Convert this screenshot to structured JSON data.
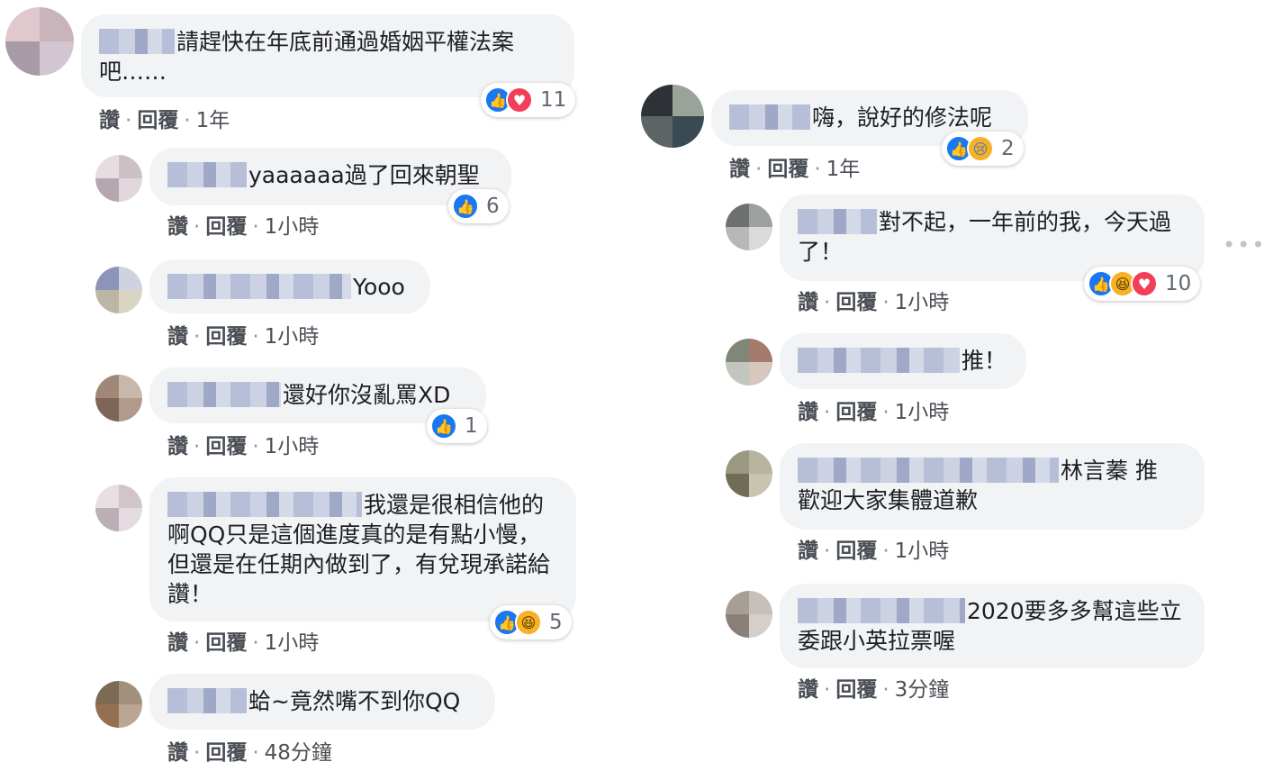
{
  "comments": [
    {
      "text": "請趕快在年底前通過婚姻平權法案吧……",
      "like_label": "讚",
      "reply_label": "回覆",
      "time": "1年",
      "reactions": {
        "icons": [
          "like-icon",
          "love-icon"
        ],
        "count": "11"
      }
    },
    {
      "text": "yaaaaaa過了回來朝聖",
      "like_label": "讚",
      "reply_label": "回覆",
      "time": "1小時",
      "reactions": {
        "icons": [
          "like-icon"
        ],
        "count": "6"
      }
    },
    {
      "text": "Yooo",
      "like_label": "讚",
      "reply_label": "回覆",
      "time": "1小時"
    },
    {
      "text": "還好你沒亂罵XD",
      "like_label": "讚",
      "reply_label": "回覆",
      "time": "1小時",
      "reactions": {
        "icons": [
          "like-icon"
        ],
        "count": "1"
      }
    },
    {
      "text": "我還是很相信他的啊QQ只是這個進度真的是有點小慢，但還是在任期內做到了，有兌現承諾給讚！",
      "like_label": "讚",
      "reply_label": "回覆",
      "time": "1小時",
      "reactions": {
        "icons": [
          "like-icon",
          "haha-icon"
        ],
        "count": "5"
      }
    },
    {
      "text": "蛤~竟然嘴不到你QQ",
      "like_label": "讚",
      "reply_label": "回覆",
      "time": "48分鐘"
    },
    {
      "text": "嗨，說好的修法呢",
      "like_label": "讚",
      "reply_label": "回覆",
      "time": "1年",
      "reactions": {
        "icons": [
          "like-icon",
          "sad-icon"
        ],
        "count": "2"
      }
    },
    {
      "text": "對不起，一年前的我，今天過了！",
      "like_label": "讚",
      "reply_label": "回覆",
      "time": "1小時",
      "reactions": {
        "icons": [
          "like-icon",
          "haha-icon",
          "love-icon"
        ],
        "count": "10"
      }
    },
    {
      "text": "推！",
      "like_label": "讚",
      "reply_label": "回覆",
      "time": "1小時"
    },
    {
      "text": "林言蓁 推 歡迎大家集體道歉",
      "like_label": "讚",
      "reply_label": "回覆",
      "time": "1小時"
    },
    {
      "text": "2020要多多幫這些立委跟小英拉票喔",
      "like_label": "讚",
      "reply_label": "回覆",
      "time": "3分鐘"
    }
  ],
  "more_options": "•••",
  "colors": {
    "like": "#1877f2",
    "love": "#f33e58",
    "haha": "#f7b125",
    "bubble": "#f2f3f5"
  }
}
